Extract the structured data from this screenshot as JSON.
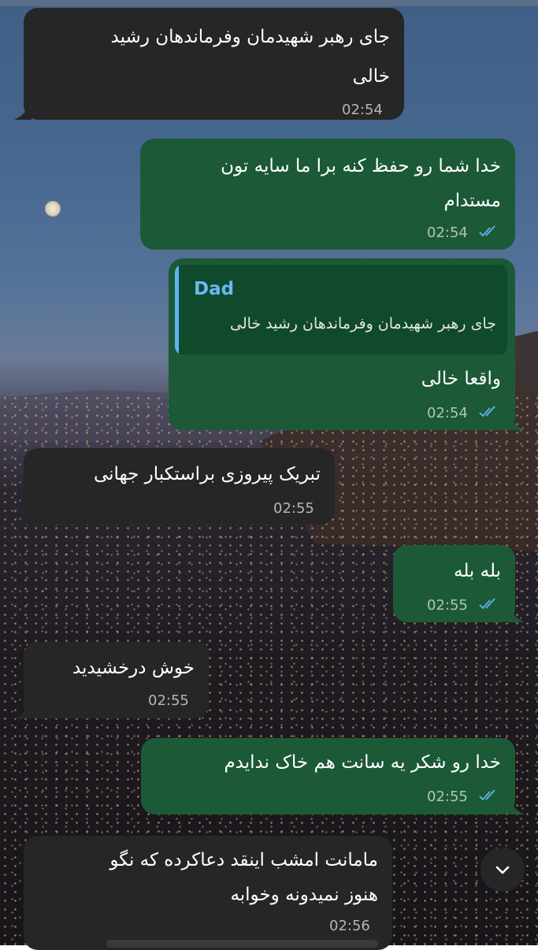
{
  "messages": [
    {
      "id": "m1",
      "dir": "in",
      "lines": [
        "جای رهبر شهیدمان وفرماندهان رشید",
        "خالی"
      ],
      "time": "02:54"
    },
    {
      "id": "m2",
      "dir": "out",
      "lines": [
        "خدا شما رو حفظ کنه برا ما سایه تون",
        "مستدام"
      ],
      "time": "02:54",
      "read": true
    },
    {
      "id": "m3",
      "dir": "out",
      "reply_to": {
        "name": "Dad",
        "text": "جای رهبر شهیدمان وفرماندهان رشید خالی"
      },
      "lines": [
        "واقعا خالی"
      ],
      "time": "02:54",
      "read": true
    },
    {
      "id": "m4",
      "dir": "in",
      "lines": [
        "تبریک  پیروزی براستکبار جهانی"
      ],
      "time": "02:55"
    },
    {
      "id": "m5",
      "dir": "out",
      "lines": [
        "بله بله"
      ],
      "time": "02:55",
      "read": true
    },
    {
      "id": "m6",
      "dir": "in",
      "lines": [
        "خوش درخشیدید"
      ],
      "time": "02:55"
    },
    {
      "id": "m7",
      "dir": "out",
      "lines": [
        "خدا رو شکر یه سانت هم خاک ندایدم"
      ],
      "time": "02:55",
      "read": true
    },
    {
      "id": "m8",
      "dir": "in",
      "lines": [
        "مامانت امشب اینقد دعاکرده که نگو",
        "هنوز نمیدونه وخوابه"
      ],
      "time": "02:56"
    }
  ],
  "icons": {
    "scroll_down": "chevron-down-icon",
    "read_status": "double-check-icon"
  },
  "colors": {
    "incoming_bubble": "#262626",
    "outgoing_bubble": "#1c5a37",
    "reply_accent": "#5fb4f0",
    "read_ticks": "#5fb4f0"
  }
}
